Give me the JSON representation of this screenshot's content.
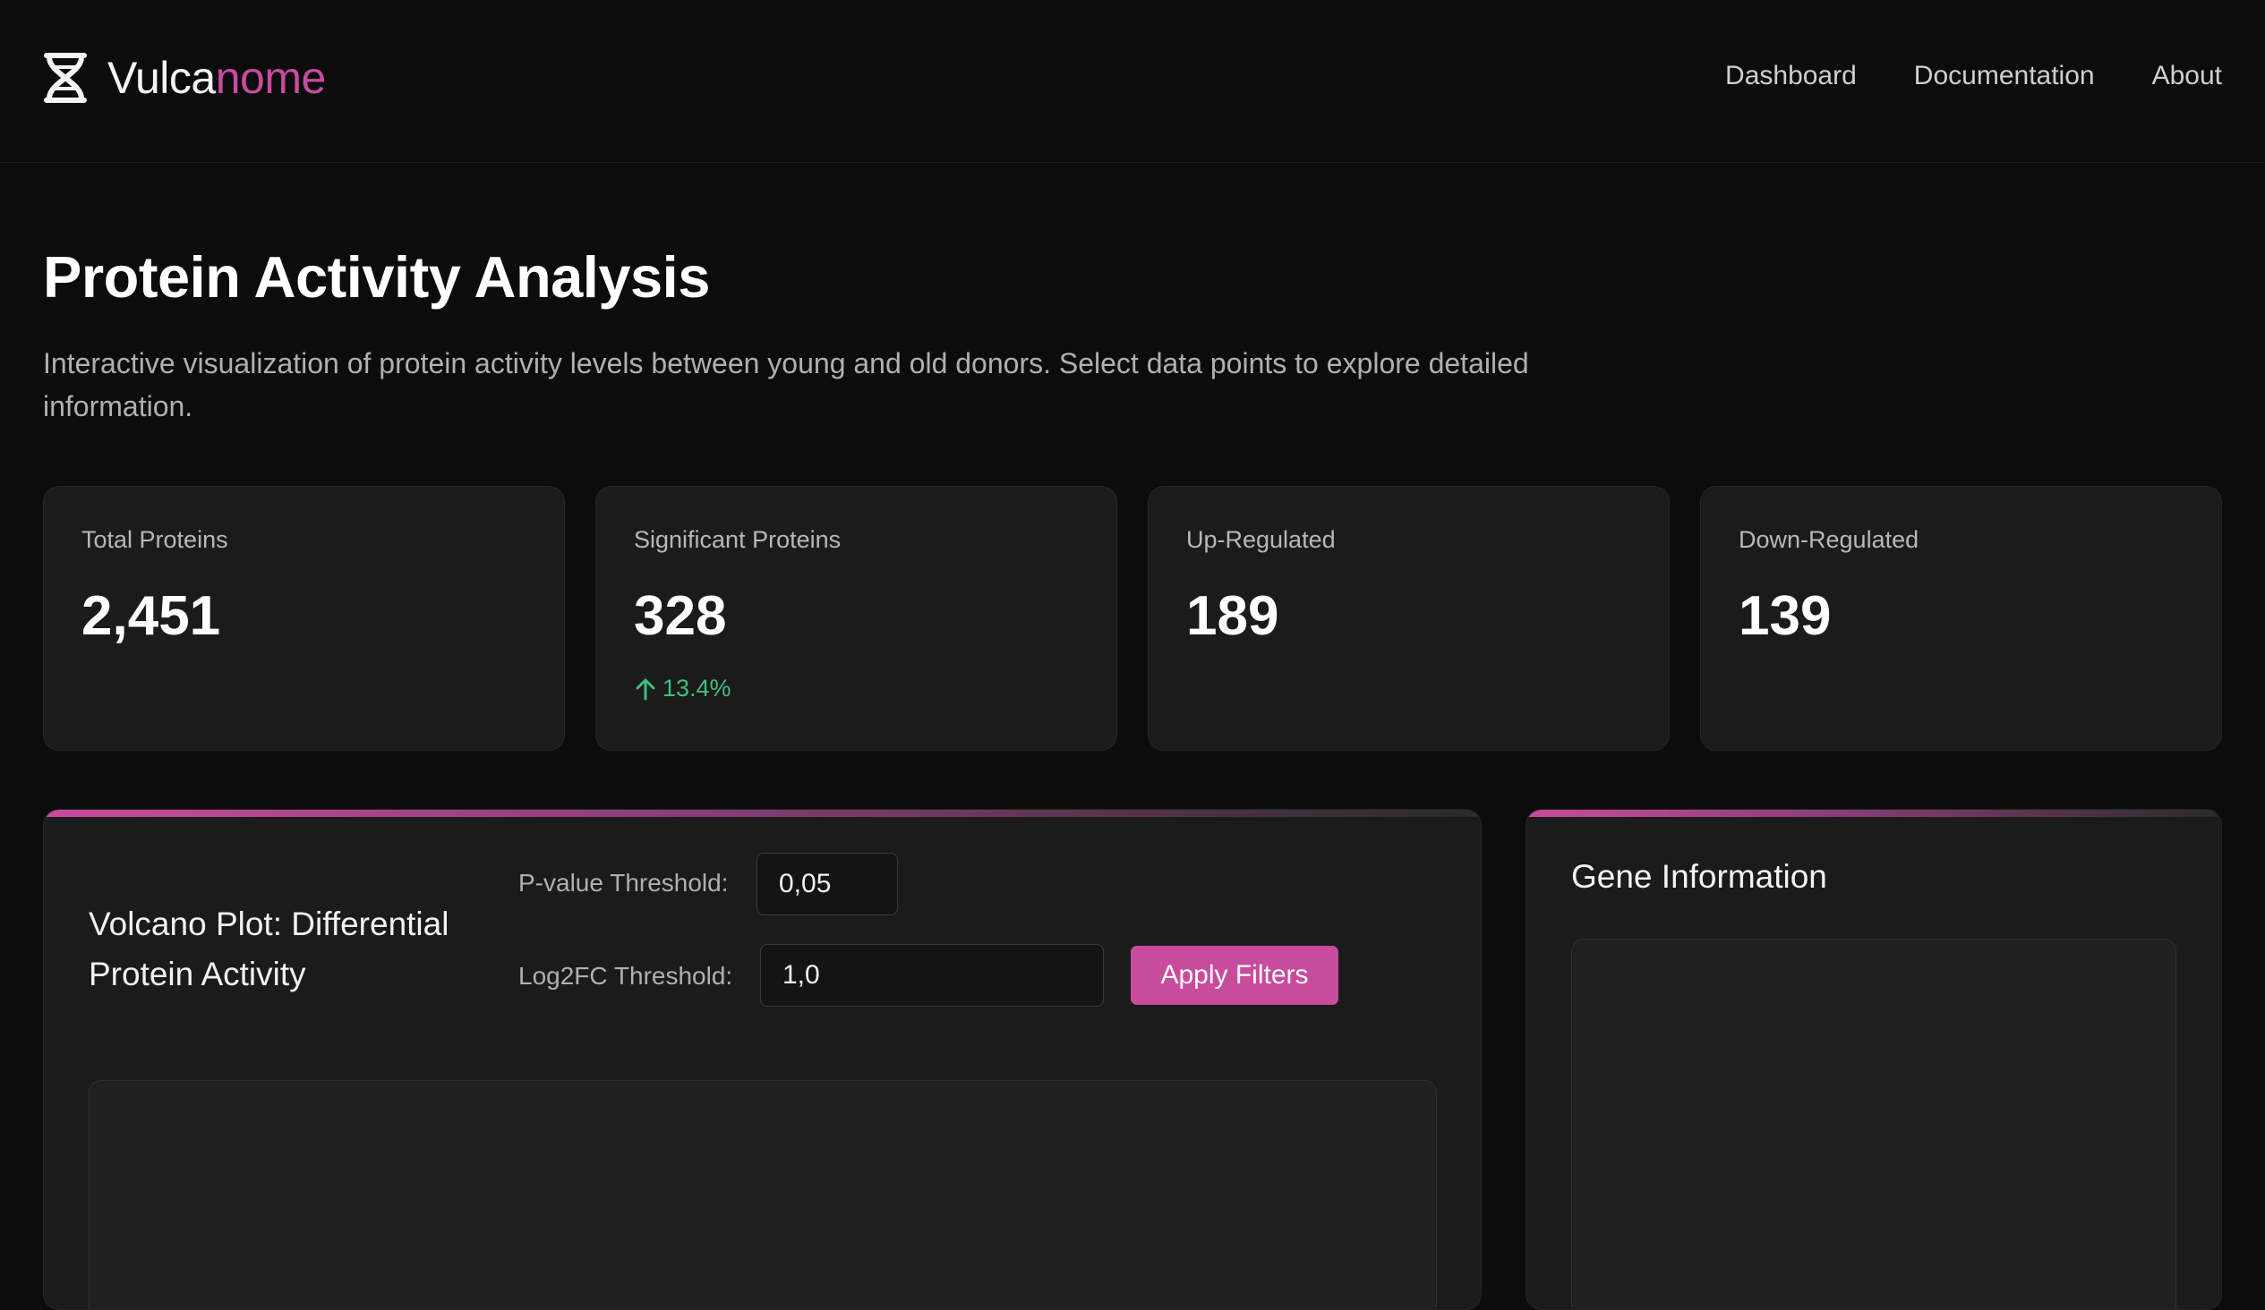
{
  "brand": {
    "name_main": "Vulca",
    "name_accent": "nome",
    "icon": "dna-icon",
    "accent_color": "#c84b9e"
  },
  "nav": {
    "items": [
      "Dashboard",
      "Documentation",
      "About"
    ]
  },
  "page": {
    "title": "Protein Activity Analysis",
    "description": "Interactive visualization of protein activity levels between young and old donors. Select data points to explore detailed information."
  },
  "stats": [
    {
      "label": "Total Proteins",
      "value": "2,451"
    },
    {
      "label": "Significant Proteins",
      "value": "328",
      "trend": "13.4%",
      "trend_icon": "arrow-up-icon",
      "trend_color": "#3fbf7f"
    },
    {
      "label": "Up-Regulated",
      "value": "189"
    },
    {
      "label": "Down-Regulated",
      "value": "139"
    }
  ],
  "volcano": {
    "title": "Volcano Plot: Differential Protein Activity",
    "pvalue_label": "P-value Threshold:",
    "pvalue_value": "0,05",
    "log2fc_label": "Log2FC Threshold:",
    "log2fc_value": "1,0",
    "apply_label": "Apply Filters"
  },
  "gene_info": {
    "title": "Gene Information"
  }
}
